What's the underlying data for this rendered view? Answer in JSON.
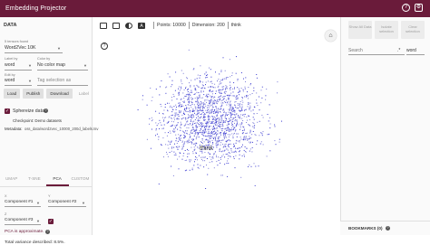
{
  "app": {
    "title": "Embedding Projector"
  },
  "left_panel": {
    "section_title": "DATA",
    "tensor_label": "5 tensors found",
    "tensor_value": "Word2Vec 10K",
    "label_by_label": "Label by",
    "label_by_value": "word",
    "color_by_label": "Color by",
    "color_by_value": "No color map",
    "edit_by_label": "Edit by",
    "edit_by_value": "word",
    "tag_placeholder": "Tag selection as",
    "buttons": {
      "load": "Load",
      "publish": "Publish",
      "download": "Download",
      "label": "Label"
    },
    "sphereize_label": "Sphereize data",
    "checkpoint_text": "Checkpoint: Demo datasets",
    "metadata_label": "Metadata:",
    "metadata_value": "oss_data/word2vec_10000_200d_labels.tsv",
    "tabs": [
      "UMAP",
      "T-SNE",
      "PCA",
      "CUSTOM"
    ],
    "x_label": "X",
    "x_value": "Component #1",
    "y_label": "Y",
    "y_value": "Component #2",
    "z_label": "Z",
    "z_value": "Component #3",
    "pca_approx": "PCA is approximate.",
    "variance": "Total variance described: 8.5%."
  },
  "toolbar": {
    "points": "Points: 10000",
    "dimension": "Dimension: 200",
    "selected": "think"
  },
  "canvas": {
    "focus_label": "think"
  },
  "right_panel": {
    "show_all": "Show All Data",
    "isolate": "Isolate selection",
    "clear": "Clear selection",
    "search_placeholder": "Search",
    "search_by": "word",
    "bookmarks_label": "BOOKMARKS (0)"
  },
  "colors": {
    "header": "#6a1b3a",
    "accent": "#6a1b3a",
    "point": "#3b3bd1"
  }
}
